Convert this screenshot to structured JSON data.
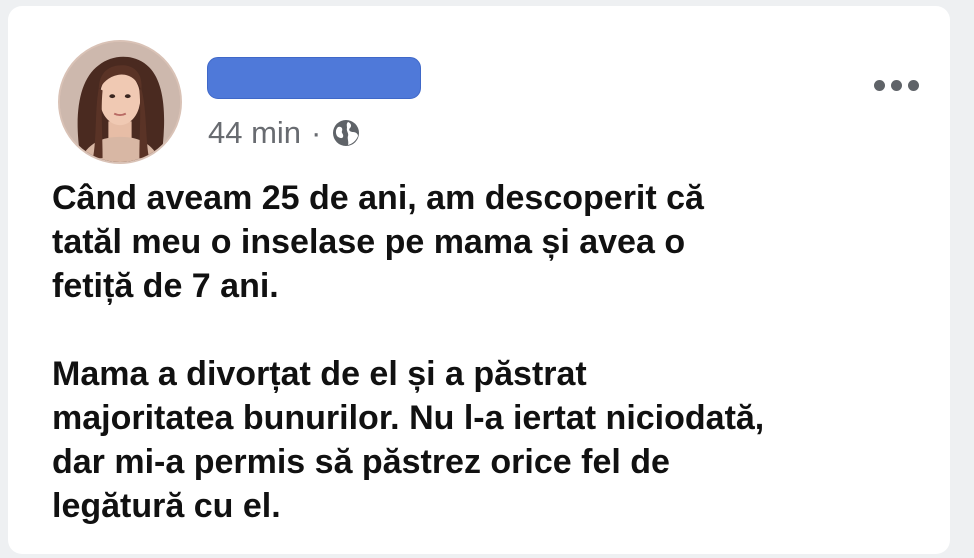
{
  "post": {
    "time": "44 min",
    "separator": "·",
    "privacy_icon": "globe-icon",
    "menu_icon": "more-options-icon",
    "paragraphs": [
      "Când aveam 25 de ani, am descoperit că\ntatăl meu o inselase pe mama și avea o\nfetiță de 7 ani.",
      "Mama a divorțat de el și a păstrat\nmajoritatea bunurilor. Nu l-a iertat niciodată,\ndar mi-a permis să păstrez orice fel de\nlegătură cu el."
    ]
  },
  "colors": {
    "name_redaction": "#4f79d9",
    "text": "#111111",
    "meta": "#686b70",
    "card": "#ffffff"
  }
}
